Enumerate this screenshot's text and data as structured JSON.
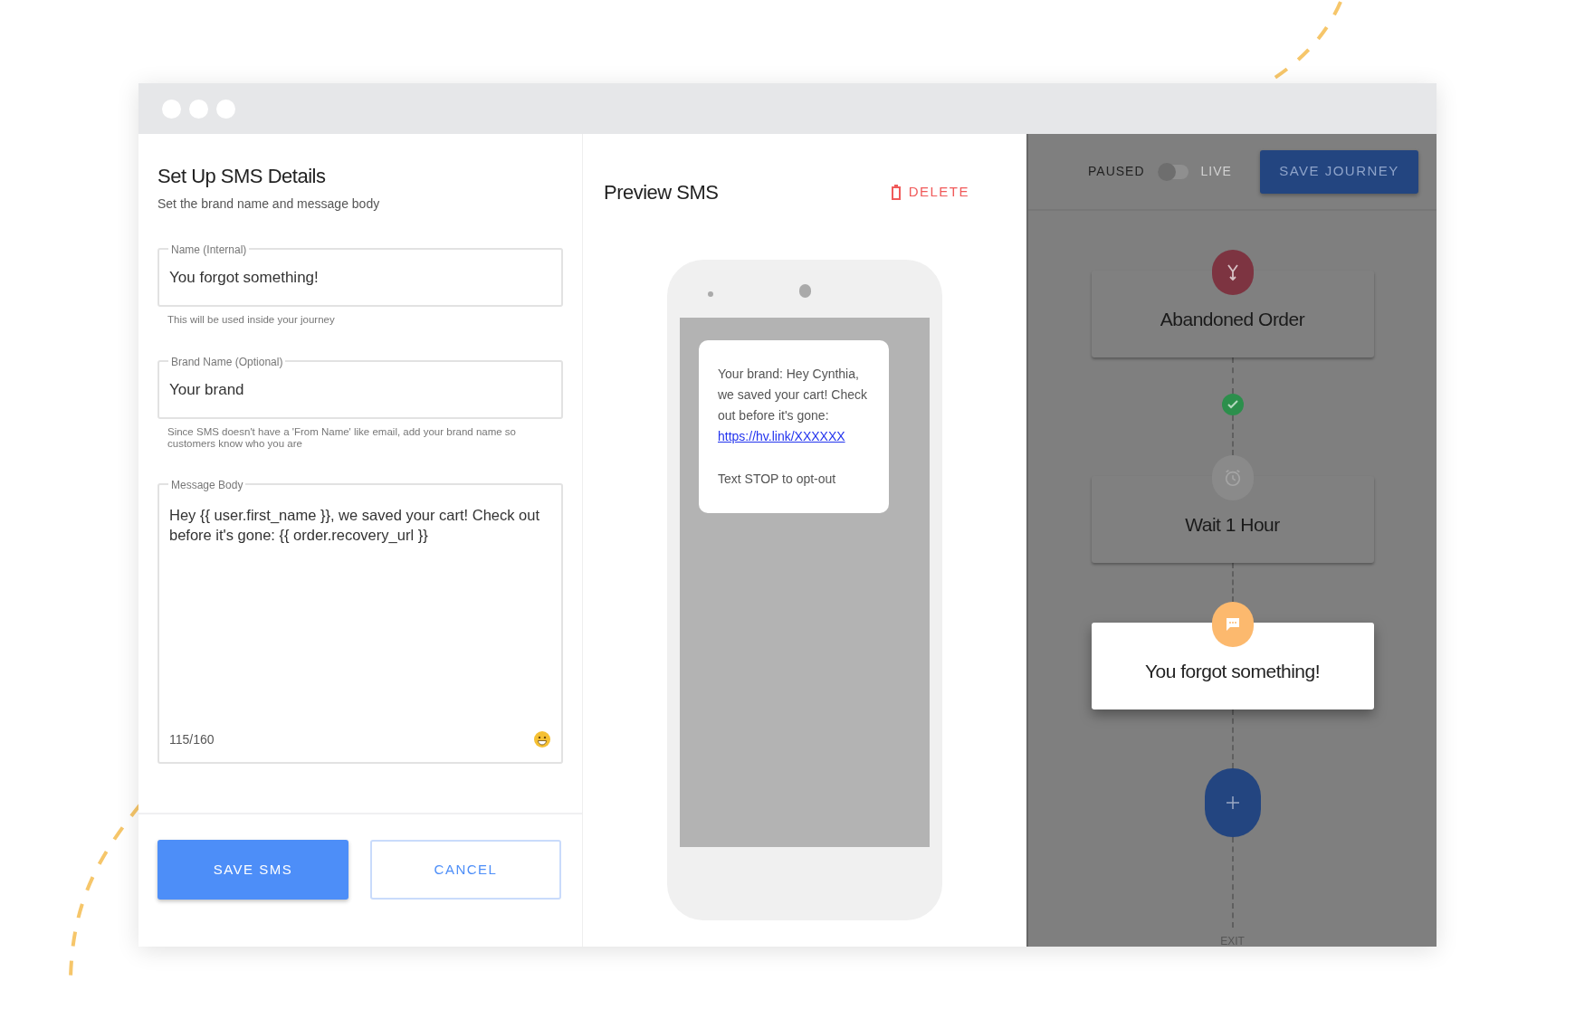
{
  "form": {
    "title": "Set Up SMS Details",
    "subtitle": "Set the brand name and message body",
    "fields": [
      {
        "label": "Name (Internal)",
        "value": "You forgot something!",
        "helper": "This will be used inside your journey"
      },
      {
        "label": "Brand Name (Optional)",
        "value": "Your brand",
        "helper": "Since SMS doesn't have a 'From Name' like email, add your brand name so customers know who you are"
      }
    ],
    "message": {
      "label": "Message Body",
      "value": "Hey {{ user.first_name }}, we saved your cart! Check out before it's gone: {{ order.recovery_url }}",
      "counter": "115/160"
    },
    "buttons": [
      {
        "label": "SAVE SMS",
        "kind": "primary"
      },
      {
        "label": "CANCEL",
        "kind": "outline"
      }
    ]
  },
  "preview": {
    "title": "Preview SMS",
    "delete": "DELETE",
    "sms": {
      "text": "Your brand: Hey Cynthia, we saved your cart! Check out before it's gone:",
      "link": "https://hv.link/XXXXXX",
      "footer": "Text STOP to opt-out"
    }
  },
  "journey": {
    "status_off": "PAUSED",
    "status_on": "LIVE",
    "live": false,
    "save": "SAVE JOURNEY",
    "nodes": [
      {
        "kind": "trigger",
        "title": "Abandoned Order",
        "color": "#7d3441",
        "selected": false
      },
      {
        "kind": "wait",
        "title": "Wait 1 Hour",
        "color": "#8a8a8a",
        "selected": false
      },
      {
        "kind": "sms",
        "title": "You forgot something!",
        "color": "#fcb96e",
        "selected": true
      }
    ],
    "exit": "EXIT"
  }
}
